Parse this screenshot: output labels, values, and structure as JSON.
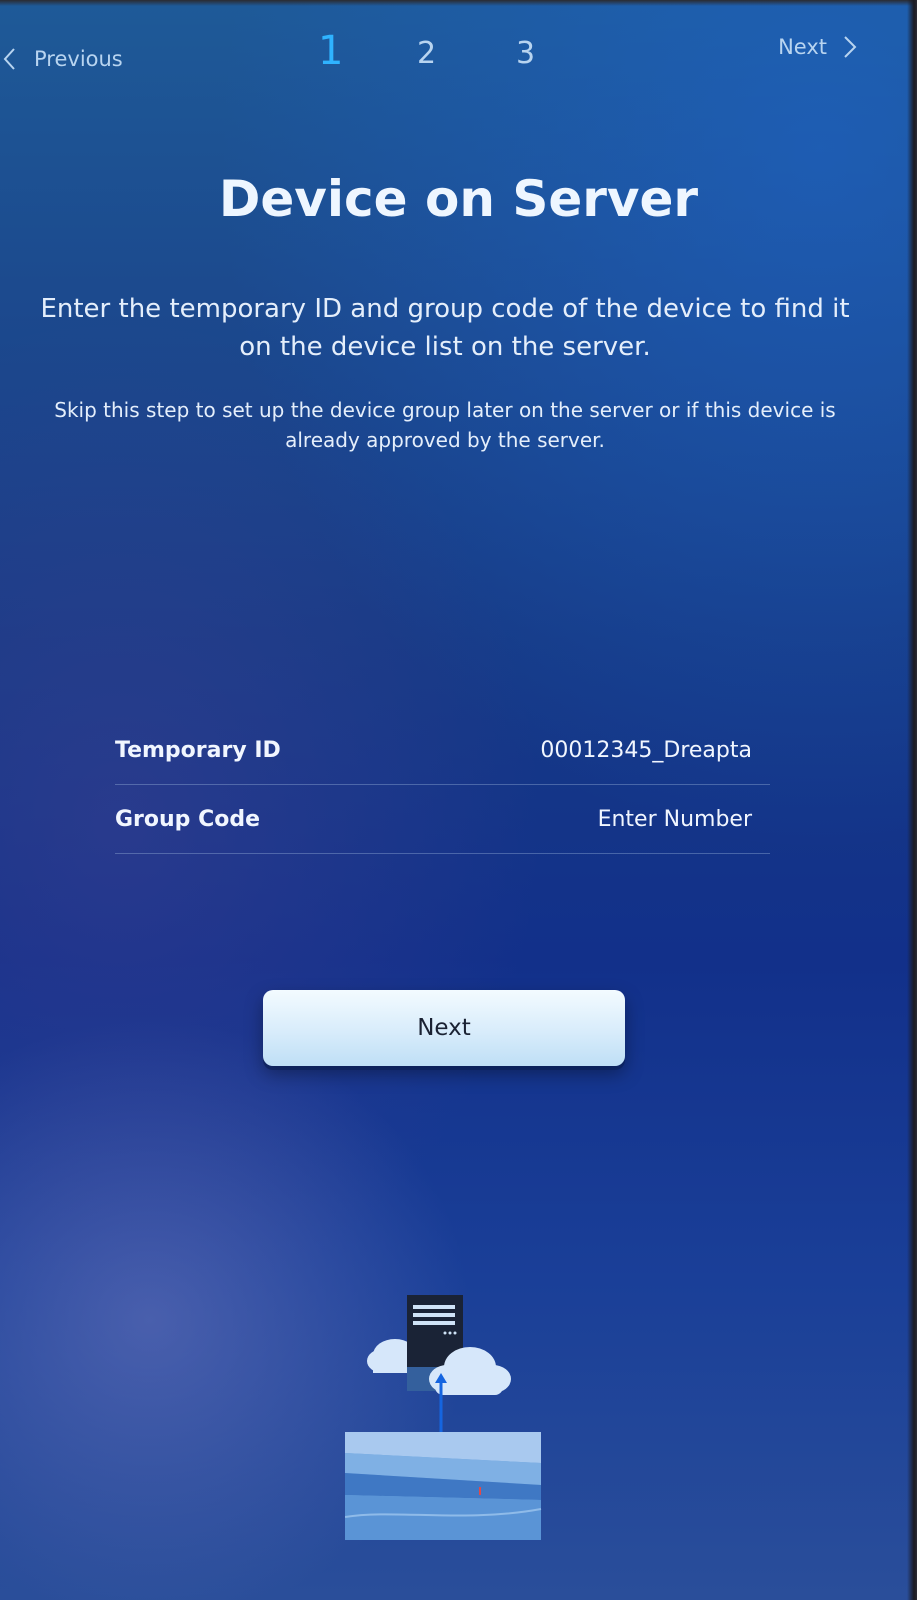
{
  "nav": {
    "previous_label": "Previous",
    "next_label": "Next",
    "steps": [
      "1",
      "2",
      "3"
    ],
    "active_step": "1"
  },
  "page": {
    "title": "Device on Server",
    "description": "Enter the temporary ID and group code of the device to find it on the device list on the server.",
    "subdescription": "Skip this step to set up the device group later on the server or if this device is already approved by the server."
  },
  "form": {
    "temporary_id": {
      "label": "Temporary ID",
      "value": "00012345_Dreapta"
    },
    "group_code": {
      "label": "Group Code",
      "value": "Enter Number"
    }
  },
  "actions": {
    "next_button": "Next"
  },
  "colors": {
    "active_step": "#2fb3ff",
    "inactive_text": "#b8d4f0",
    "button_bg": "#d8ecfb",
    "background": "#163a86"
  },
  "icons": {
    "previous": "chevron-left-icon",
    "next": "chevron-right-icon",
    "illustration": "server-cloud-sync-illustration"
  }
}
